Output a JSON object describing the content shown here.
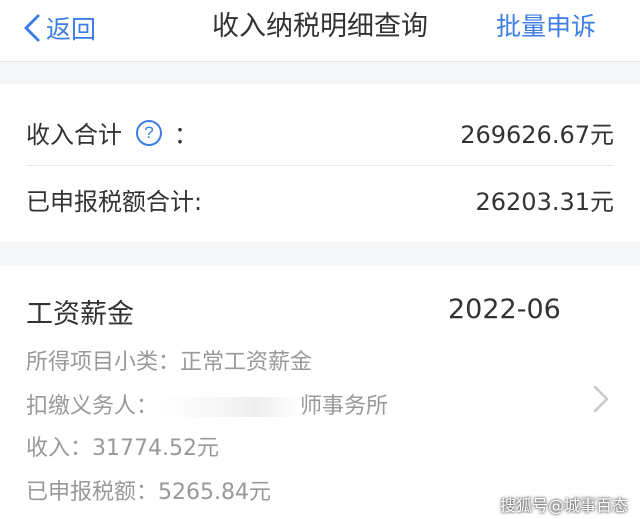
{
  "nav": {
    "back_label": "返回",
    "title": "收入纳税明细查询",
    "batch_label": "批量申诉"
  },
  "summary": {
    "income_label": "收入合计",
    "income_colon": "：",
    "income_value": "269626.67元",
    "tax_label": "已申报税额合计:",
    "tax_value": "26203.31元"
  },
  "record": {
    "type": "工资薪金",
    "date": "2022-06",
    "subtype_label": "所得项目小类：",
    "subtype_value": "正常工资薪金",
    "withholder_label": "扣缴义务人：",
    "withholder_value": "师事务所",
    "income_label": "收入：",
    "income_value": "31774.52元",
    "tax_label": "已申报税额：",
    "tax_value": "5265.84元"
  },
  "watermark": "搜狐号@城事百态",
  "colors": {
    "accent": "#3d7ee6",
    "text": "#333333",
    "muted": "#999999",
    "background": "#f5f6f8"
  },
  "icons": {
    "back": "chevron-left-icon",
    "help": "question-circle-icon",
    "detail": "chevron-right-icon"
  }
}
